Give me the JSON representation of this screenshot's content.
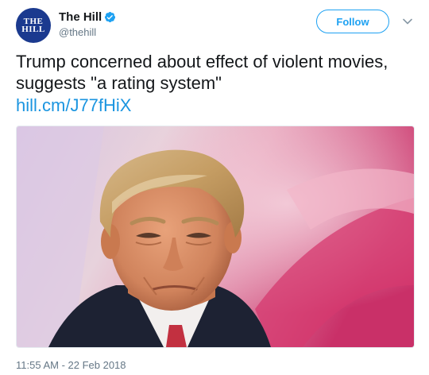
{
  "account": {
    "display_name": "The Hill",
    "handle": "@thehill",
    "avatar_logo": [
      "THE",
      "HILL"
    ],
    "verified": true,
    "avatar_color": "#1b3a8f",
    "verified_color": "#1da1f2"
  },
  "actions": {
    "follow_label": "Follow",
    "menu_icon": "chevron-down-icon"
  },
  "tweet": {
    "text": "Trump concerned about effect of violent movies, suggests \"a rating system\"",
    "link": "hill.cm/J77fHiX",
    "media_description": "photo",
    "timestamp": "11:55 AM - 22 Feb 2018"
  },
  "colors": {
    "accent": "#1da1f2",
    "link": "#1b95e0",
    "secondary_text": "#657786",
    "primary_text": "#14171a"
  }
}
